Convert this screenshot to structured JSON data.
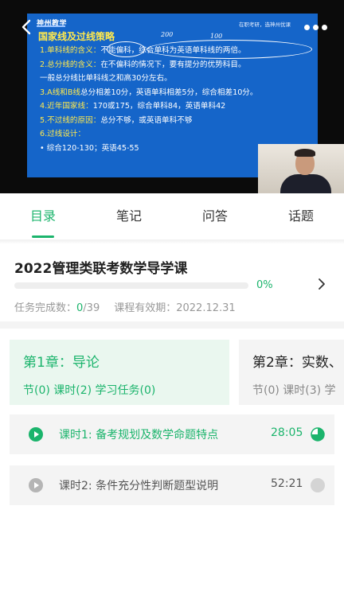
{
  "video": {
    "slide": {
      "logo": "神州教学",
      "corner_text": "在职考研，选神州优课",
      "title": "国家线及过线策略",
      "annotations": [
        "200",
        "100"
      ],
      "lines": [
        {
          "key": "1.单科线的含义：",
          "text": "不能偏科，综合单科为英语单科线的两倍。"
        },
        {
          "key": "2.总分线的含义：",
          "text": "在不偏科的情况下，要有提分的优势科目。"
        },
        {
          "key": "",
          "text": "一般总分线比单科线之和高30分左右。"
        },
        {
          "key": "3.A线和B线",
          "text": "总分相差10分，英语单科相差5分，综合相差10分。"
        },
        {
          "key": "4.近年国家线：",
          "text": "170或175，综合单科84，英语单科42"
        },
        {
          "key": "5.不过线的原因：",
          "text": "总分不够，或英语单科不够"
        },
        {
          "key": "6.过线设计：",
          "text": ""
        },
        {
          "key": "",
          "text": "• 综合120-130；英语45-55"
        }
      ]
    }
  },
  "tabs": [
    {
      "label": "目录",
      "active": true
    },
    {
      "label": "笔记",
      "active": false
    },
    {
      "label": "问答",
      "active": false
    },
    {
      "label": "话题",
      "active": false
    }
  ],
  "course": {
    "title": "2022管理类联考数学导学课",
    "progress": 0,
    "progress_label": "0%",
    "tasks_label": "任务完成数：",
    "tasks_done": "0",
    "tasks_total": "/39",
    "validity_label": "课程有效期：",
    "validity": "2022.12.31"
  },
  "chapters": [
    {
      "title": "第1章：导论",
      "meta": "节(0) 课时(2) 学习任务(0)",
      "selected": true
    },
    {
      "title": "第2章：实数、",
      "meta": "节(0) 课时(3) 学",
      "selected": false
    }
  ],
  "lessons": [
    {
      "title": "课时1: 备考规划及数学命题特点",
      "duration": "28:05",
      "active": true,
      "watched_fraction": 0.75
    },
    {
      "title": "课时2: 条件充分性判断题型说明",
      "duration": "52:21",
      "active": false,
      "watched_fraction": 0
    }
  ],
  "colors": {
    "accent": "#1bb46c",
    "slide_bg": "#1565c9",
    "slide_highlight": "#ffe94d",
    "card_bg": "#f4f4f4",
    "selected_card_bg": "#eaf7ef"
  }
}
